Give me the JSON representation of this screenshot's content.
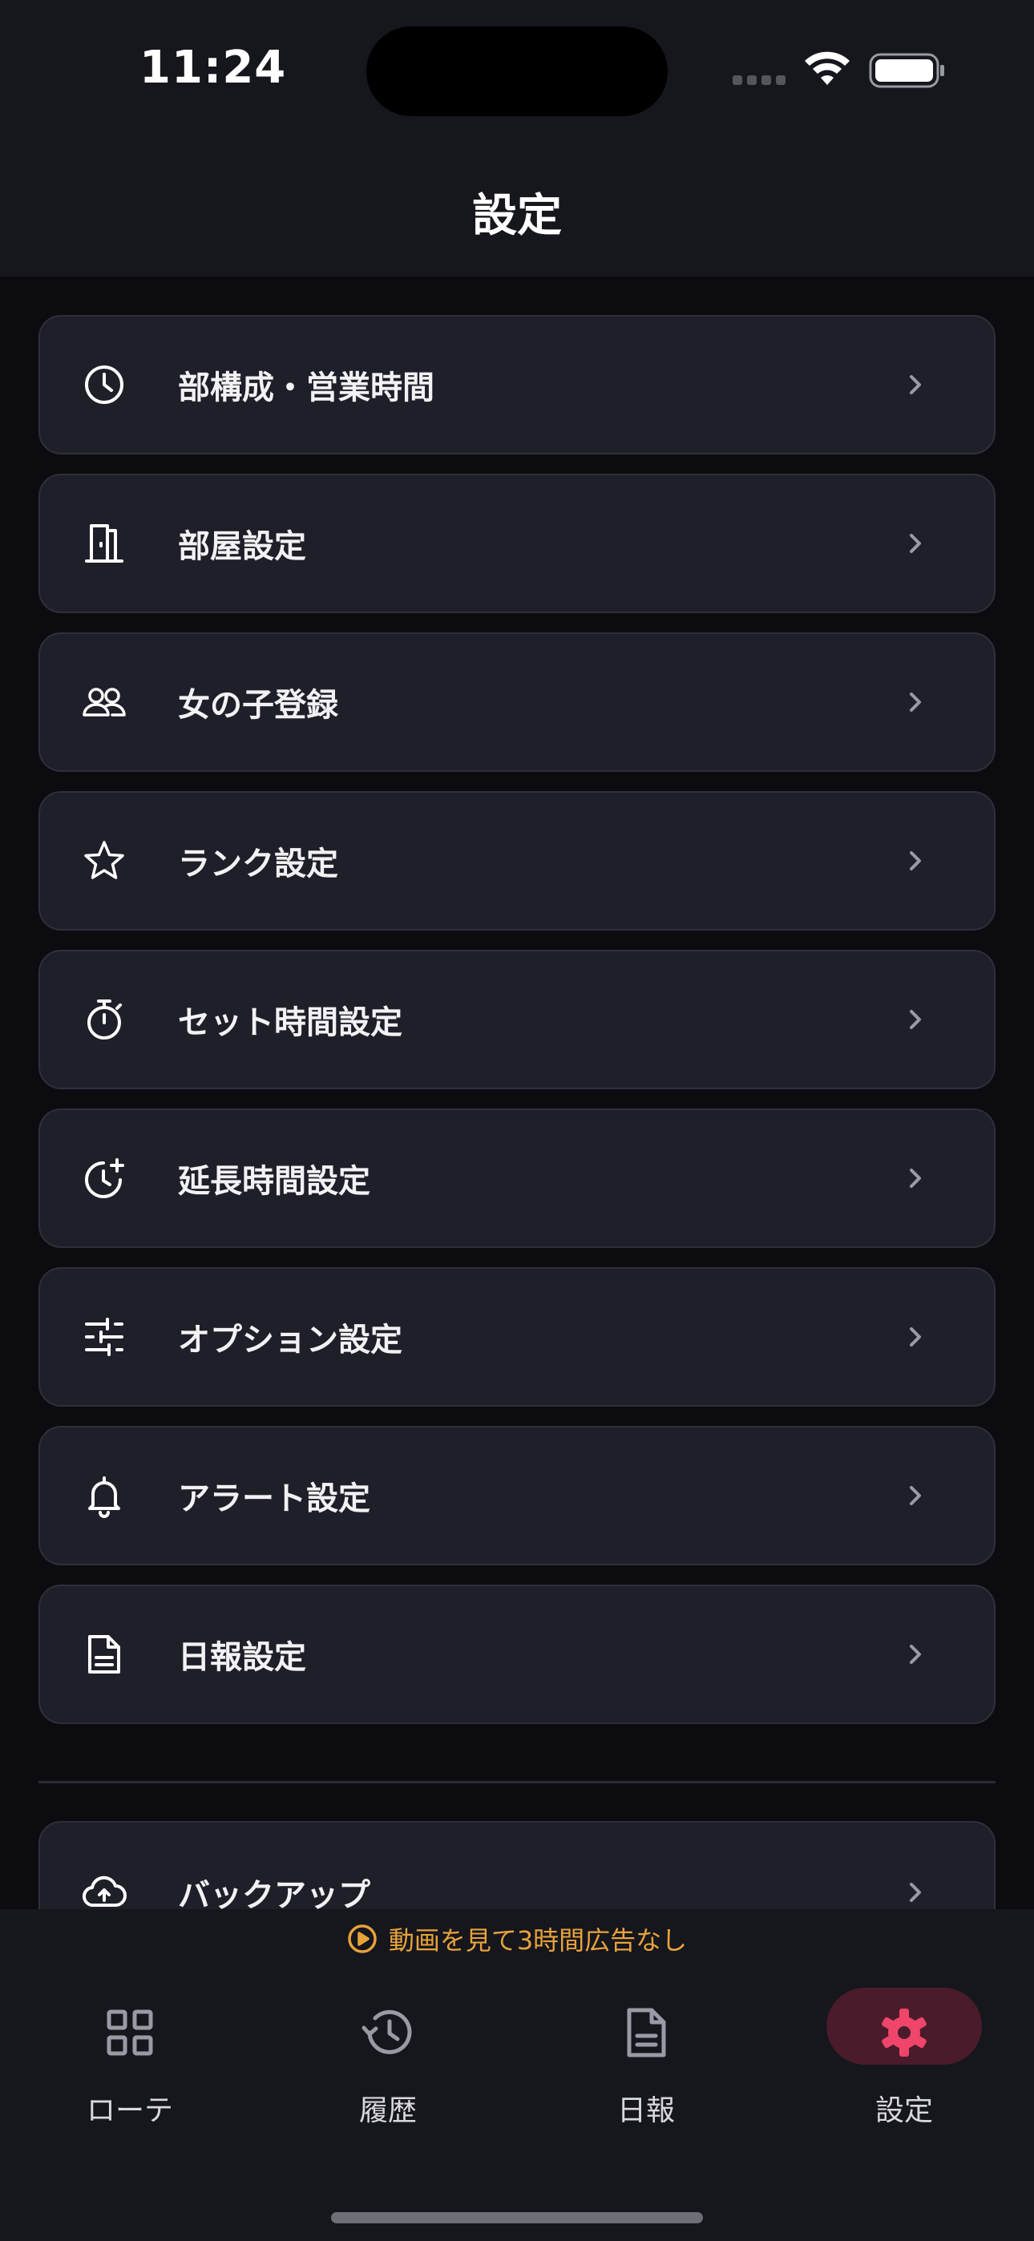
{
  "status_bar": {
    "time": "11:24"
  },
  "header": {
    "title": "設定"
  },
  "settings_items": [
    {
      "label": "部構成・営業時間",
      "icon": "clock-icon"
    },
    {
      "label": "部屋設定",
      "icon": "door-icon"
    },
    {
      "label": "女の子登録",
      "icon": "users-icon"
    },
    {
      "label": "ランク設定",
      "icon": "star-icon"
    },
    {
      "label": "セット時間設定",
      "icon": "stopwatch-icon"
    },
    {
      "label": "延長時間設定",
      "icon": "clock-plus-icon"
    },
    {
      "label": "オプション設定",
      "icon": "sliders-icon"
    },
    {
      "label": "アラート設定",
      "icon": "bell-icon"
    },
    {
      "label": "日報設定",
      "icon": "document-icon"
    }
  ],
  "backup_item": {
    "label": "バックアップ",
    "icon": "cloud-upload-icon"
  },
  "ad_banner": {
    "text": "動画を見て3時間広告なし",
    "icon": "play-circle-icon"
  },
  "tabs": [
    {
      "label": "ローテ",
      "icon": "grid-icon",
      "active": false
    },
    {
      "label": "履歴",
      "icon": "history-icon",
      "active": false
    },
    {
      "label": "日報",
      "icon": "document-icon",
      "active": false
    },
    {
      "label": "設定",
      "icon": "gear-icon",
      "active": true
    }
  ],
  "colors": {
    "background": "#0c0c10",
    "header_bg": "#16161d",
    "row_bg": "#1f1f29",
    "row_border": "#2f2f3c",
    "accent": "#f0456a",
    "active_pill": "#4a1b2a",
    "ad_text": "#e7a33b"
  }
}
